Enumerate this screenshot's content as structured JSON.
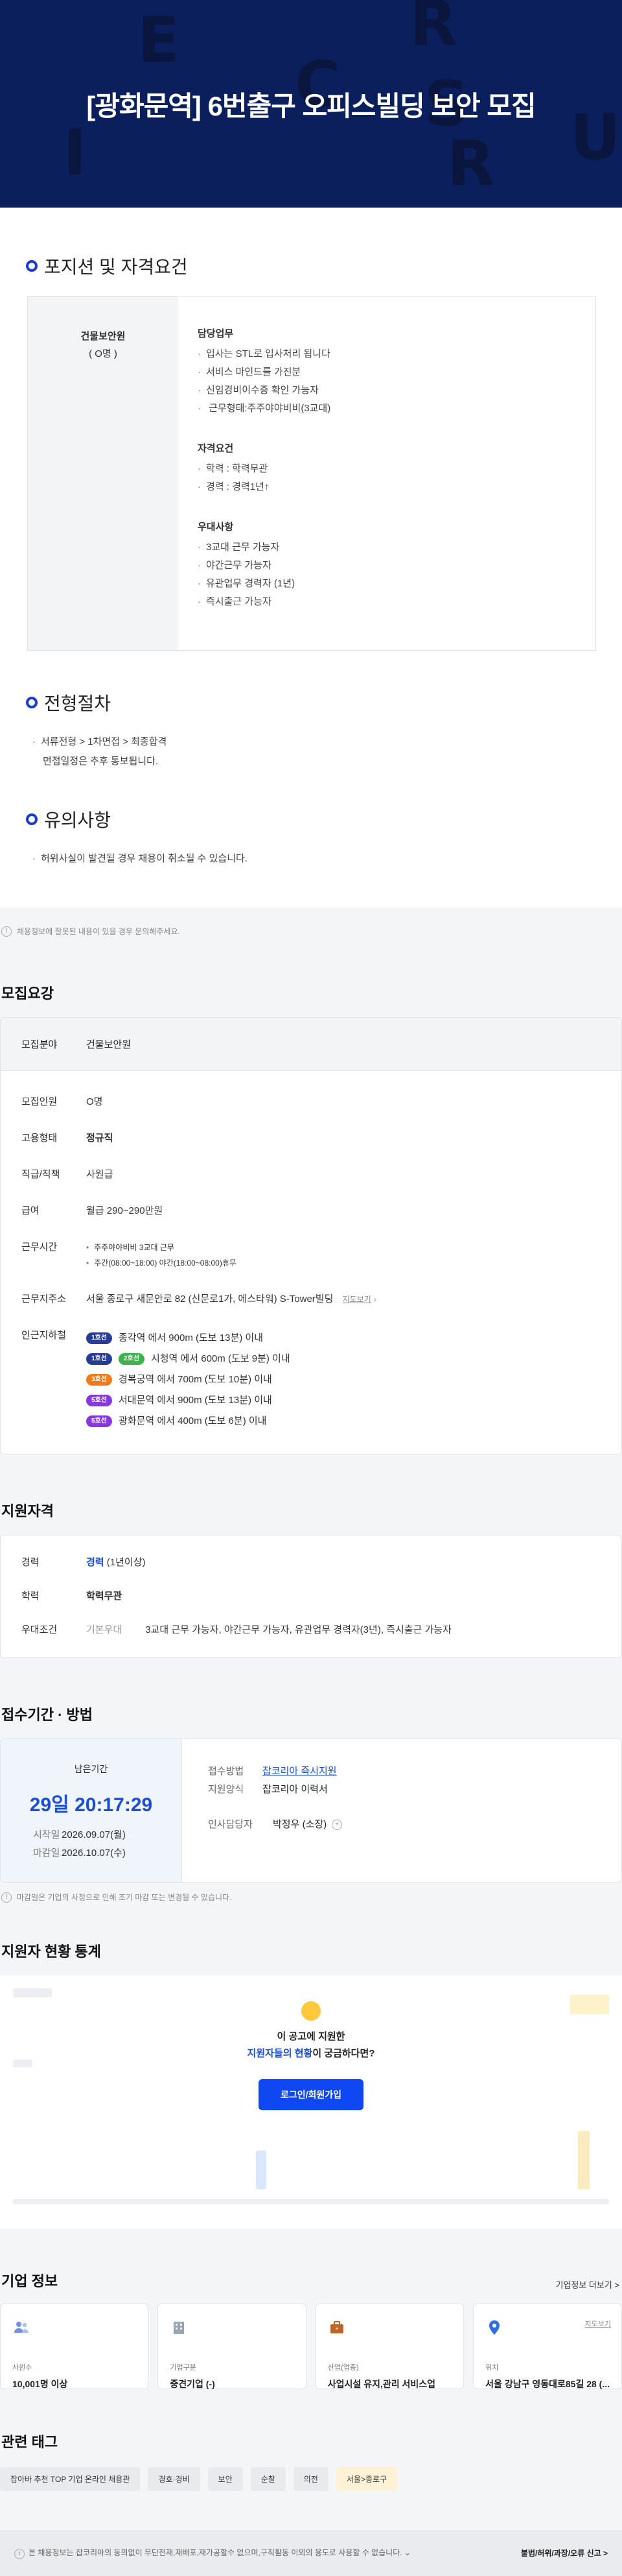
{
  "hero": {
    "title": "[광화문역] 6번출구 오피스빌딩 보안 모집"
  },
  "detail": {
    "position_title": "포지션 및 자격요건",
    "position": {
      "name": "건물보안원",
      "count": "( O명 )"
    },
    "duties_title": "담당업무",
    "duties": [
      "입사는 STL로 입사처리 됩니다",
      "서비스 마인드를 가진분",
      "신임경비이수증 확인 가능자",
      " 근무형태:주주야야비비(3교대)"
    ],
    "req_title": "자격요건",
    "reqs": [
      "학력 : 학력무관",
      "경력 : 경력1년↑"
    ],
    "pref_title": "우대사항",
    "prefs": [
      "3교대 근무 가능자",
      "야간근무 가능자",
      "유관업무 경력자 (1년)",
      "즉시출근 가능자"
    ],
    "process_title": "전형절차",
    "process": [
      "서류전형 > 1차면접 > 최종합격",
      "면접일정은 추후 통보됩니다."
    ],
    "caution_title": "유의사항",
    "cautions": [
      "허위사실이 발견될 경우 채용이 취소될 수 있습니다."
    ],
    "notice": "채용정보에 잘못된 내용이 있을 경우 문의해주세요."
  },
  "recruit": {
    "title": "모집요강",
    "field_k": "모집분야",
    "field_v": "건물보안원",
    "count_k": "모집인원",
    "count_v": "O명",
    "type_k": "고용형태",
    "type_v": "정규직",
    "rank_k": "직급/직책",
    "rank_v": "사원급",
    "pay_k": "급여",
    "pay_v": "월급 290~290만원",
    "hours_k": "근무시간",
    "hours": [
      "주주야야비비 3교대 근무",
      "주간(08:00~18:00) 야간(18:00~08:00)휴무"
    ],
    "addr_k": "근무지주소",
    "addr_v": "서울 종로구 새문안로 82 (신문로1가, 에스타워) S-Tower빌딩",
    "addr_map": "지도보기",
    "subway_k": "인근지하철",
    "subways": [
      {
        "lines": [
          {
            "name": "1호선",
            "color": "#263c96"
          }
        ],
        "text": "종각역 에서 900m (도보 13분) 이내"
      },
      {
        "lines": [
          {
            "name": "1호선",
            "color": "#263c96"
          },
          {
            "name": "2호선",
            "color": "#3cb44a"
          }
        ],
        "text": "시청역 에서 600m (도보 9분) 이내"
      },
      {
        "lines": [
          {
            "name": "3호선",
            "color": "#ef7c1c"
          }
        ],
        "text": "경복궁역 에서 700m (도보 10분) 이내"
      },
      {
        "lines": [
          {
            "name": "5호선",
            "color": "#8936e0"
          }
        ],
        "text": "서대문역 에서 900m (도보 13분) 이내"
      },
      {
        "lines": [
          {
            "name": "5호선",
            "color": "#8936e0"
          }
        ],
        "text": "광화문역 에서 400m (도보 6분) 이내"
      }
    ]
  },
  "qual": {
    "title": "지원자격",
    "career_k": "경력",
    "career_v": "경력",
    "career_sub": "(1년이상)",
    "edu_k": "학력",
    "edu_v": "학력무관",
    "pref_k": "우대조건",
    "pref_tag": "기본우대",
    "pref_v": "3교대 근무 가능자, 야간근무 가능자, 유관업무 경력자(3년), 즉시출근 가능자"
  },
  "period": {
    "title": "접수기간 · 방법",
    "remain_label": "남은기간",
    "remain": "29일 20:17:29",
    "start_k": "시작일",
    "start_v": "2026.09.07(월)",
    "end_k": "마감일",
    "end_v": "2026.10.07(수)",
    "method_k": "접수방법",
    "method_v": "잡코리아 즉시지원",
    "form_k": "지원양식",
    "form_v": "잡코리아 이력서",
    "hr_k": "인사담당자",
    "hr_v": "박정우 (소장)",
    "notice": "마감일은 기업의 사정으로 인해 조기 마감 또는 변경될 수 있습니다."
  },
  "stats": {
    "title": "지원자 현황 통계",
    "line1": "이 공고에 지원한",
    "line2_hl": "지원자들의 현황",
    "line2_rest": "이 궁금하다면?",
    "button": "로그인/회원가입"
  },
  "corp": {
    "title": "기업 정보",
    "more": "기업정보 더보기 >",
    "cards": [
      {
        "icon": "people-icon",
        "k": "사원수",
        "v": "10,001명 이상"
      },
      {
        "icon": "building-icon",
        "k": "기업구분",
        "v": "중견기업 (-)"
      },
      {
        "icon": "briefcase-icon",
        "k": "산업(업종)",
        "v": "사업시설 유지,관리 서비스업"
      },
      {
        "icon": "location-pin-icon",
        "k": "위치",
        "v": "서울 강남구 영동대로85길 28 (..."
      }
    ],
    "map": "지도보기"
  },
  "tags": {
    "title": "관련 태그",
    "items": [
      "잡아바 추천 TOP 기업 온라인 채용관",
      "경호·경비",
      "보안",
      "순찰",
      "의전",
      "서울>종로구"
    ]
  },
  "footer": {
    "text": "본 채용정보는 잡코리아의 동의없이 무단전재,재배포,재가공할수 없으며,구직활동 이외의 용도로 사용할 수 없습니다. ⌄",
    "report": "불법/허위/과장/오류 신고 >"
  },
  "colors": {
    "accent": "#1c4fd1",
    "hero": "#0a1f5c",
    "button": "#0f47f2"
  }
}
